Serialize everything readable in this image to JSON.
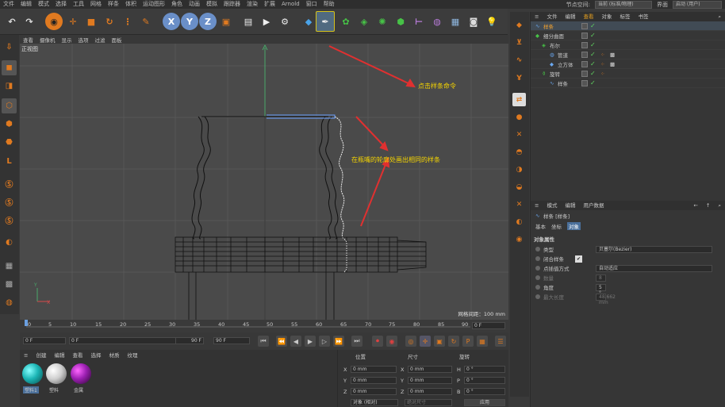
{
  "menubar": {
    "items": [
      "文件",
      "编辑",
      "模式",
      "选择",
      "工具",
      "网格",
      "样条",
      "体积",
      "运动图形",
      "角色",
      "动画",
      "模拟",
      "跟踪器",
      "渲染",
      "扩展",
      "Arnold",
      "窗口",
      "帮助"
    ],
    "layout_label": "节点空间:",
    "layout_value": "当前 (标准/物理)",
    "interface_label": "界面",
    "interface_value": "启动 (用户)"
  },
  "viewport": {
    "menu": [
      "查看",
      "摄像机",
      "显示",
      "选项",
      "过滤",
      "面板"
    ],
    "view_name": "正视图",
    "grid_spacing": "网格间距：100 mm"
  },
  "annotations": {
    "a1": "点击样条命令",
    "a2": "在瓶嘴的轮廓处画出相同的样条"
  },
  "objects": {
    "tabs": [
      "文件",
      "编辑",
      "查看",
      "对象",
      "标签",
      "书签"
    ],
    "rows": [
      {
        "name": "样条",
        "icon": "spline-icon"
      },
      {
        "name": "细分曲面",
        "icon": "subdivision-icon"
      },
      {
        "name": "布尔",
        "icon": "boolean-icon"
      },
      {
        "name": "管道",
        "icon": "tube-icon"
      },
      {
        "name": "立方体",
        "icon": "cube-icon"
      },
      {
        "name": "旋转",
        "icon": "lathe-icon"
      },
      {
        "name": "样条",
        "icon": "spline-icon"
      }
    ]
  },
  "attributes": {
    "tabs": [
      "模式",
      "编辑",
      "用户数据"
    ],
    "object_title": "样条 [样条]",
    "subtabs": [
      "基本",
      "坐标",
      "对象"
    ],
    "section": "对象属性",
    "fields": [
      {
        "label": "类型",
        "value": "贝塞尔(Bezier)"
      },
      {
        "label": "闭合样条",
        "value": "✔"
      },
      {
        "label": "点插值方式",
        "value": "自动适应"
      },
      {
        "label": "数量",
        "value": "8"
      },
      {
        "label": "角度",
        "value": "5 °"
      },
      {
        "label": "最大长度",
        "value": "48.662 mm"
      }
    ]
  },
  "timeline": {
    "ticks": [
      "0",
      "5",
      "10",
      "15",
      "20",
      "25",
      "30",
      "35",
      "40",
      "45",
      "50",
      "55",
      "60",
      "65",
      "70",
      "75",
      "80",
      "85",
      "90"
    ],
    "current": "0 F"
  },
  "transport": {
    "start": "0 F",
    "field2": "0 F",
    "end1": "90 F",
    "end2": "90 F"
  },
  "materials": {
    "menu": [
      "创建",
      "编辑",
      "查看",
      "选择",
      "材质",
      "纹理"
    ],
    "items": [
      {
        "name": "塑料1",
        "color": "#1bb5b5"
      },
      {
        "name": "塑料",
        "color": "#cfcfcf"
      },
      {
        "name": "金属",
        "color": "#9a1fb0"
      }
    ]
  },
  "coords": {
    "headers": [
      "位置",
      "尺寸",
      "旋转"
    ],
    "rows": [
      {
        "axis": "X",
        "pos": "0 mm",
        "size": "0 mm",
        "rot_axis": "H",
        "rot": "0 °"
      },
      {
        "axis": "Y",
        "pos": "0 mm",
        "size": "0 mm",
        "rot_axis": "P",
        "rot": "0 °"
      },
      {
        "axis": "Z",
        "pos": "0 mm",
        "size": "0 mm",
        "rot_axis": "B",
        "rot": "0 °"
      }
    ],
    "mode": "对象 (相对)",
    "size_mode": "绝对尺寸",
    "apply": "应用"
  }
}
